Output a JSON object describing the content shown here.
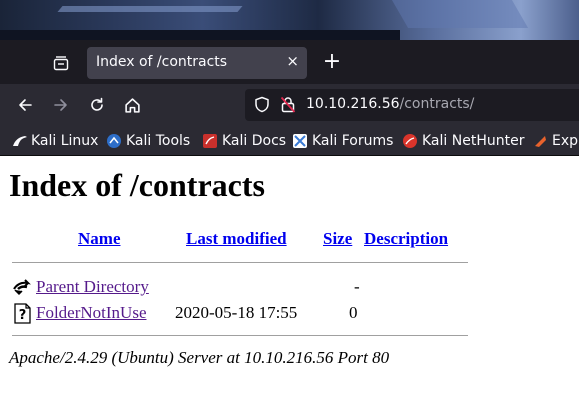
{
  "browser": {
    "tab_title": "Index of /contracts",
    "tab_close": "×",
    "new_tab": "+",
    "url_host": "10.10.216.56",
    "url_path": "/contracts/"
  },
  "bookmarks": [
    {
      "label": "Kali Linux",
      "icon": "kali-dragon-icon",
      "color": "#2b2a33"
    },
    {
      "label": "Kali Tools",
      "icon": "kali-tools-icon",
      "color": "#2d6ec9"
    },
    {
      "label": "Kali Docs",
      "icon": "kali-docs-icon",
      "color": "#c9302c"
    },
    {
      "label": "Kali Forums",
      "icon": "kali-forums-icon",
      "color": "#3a7bd5"
    },
    {
      "label": "Kali NetHunter",
      "icon": "nethunter-icon",
      "color": "#d9342b"
    },
    {
      "label": "Expl",
      "icon": "exploit-db-icon",
      "color": "#e8622c"
    }
  ],
  "page": {
    "heading": "Index of /contracts",
    "columns": [
      "Name",
      "Last modified",
      "Size",
      "Description"
    ],
    "rows": [
      {
        "name": "Parent Directory",
        "modified": "",
        "size": "-",
        "description": "",
        "icon": "back-arrow-icon"
      },
      {
        "name": "FolderNotInUse",
        "modified": "2020-05-18 17:55",
        "size": "0",
        "description": "",
        "icon": "unknown-file-icon"
      }
    ],
    "footer": "Apache/2.4.29 (Ubuntu) Server at 10.10.216.56 Port 80"
  },
  "colors": {
    "link": "#0000ee",
    "visited_link": "#551a8b",
    "chrome_dark": "#1c1b22",
    "chrome": "#2b2a33"
  }
}
